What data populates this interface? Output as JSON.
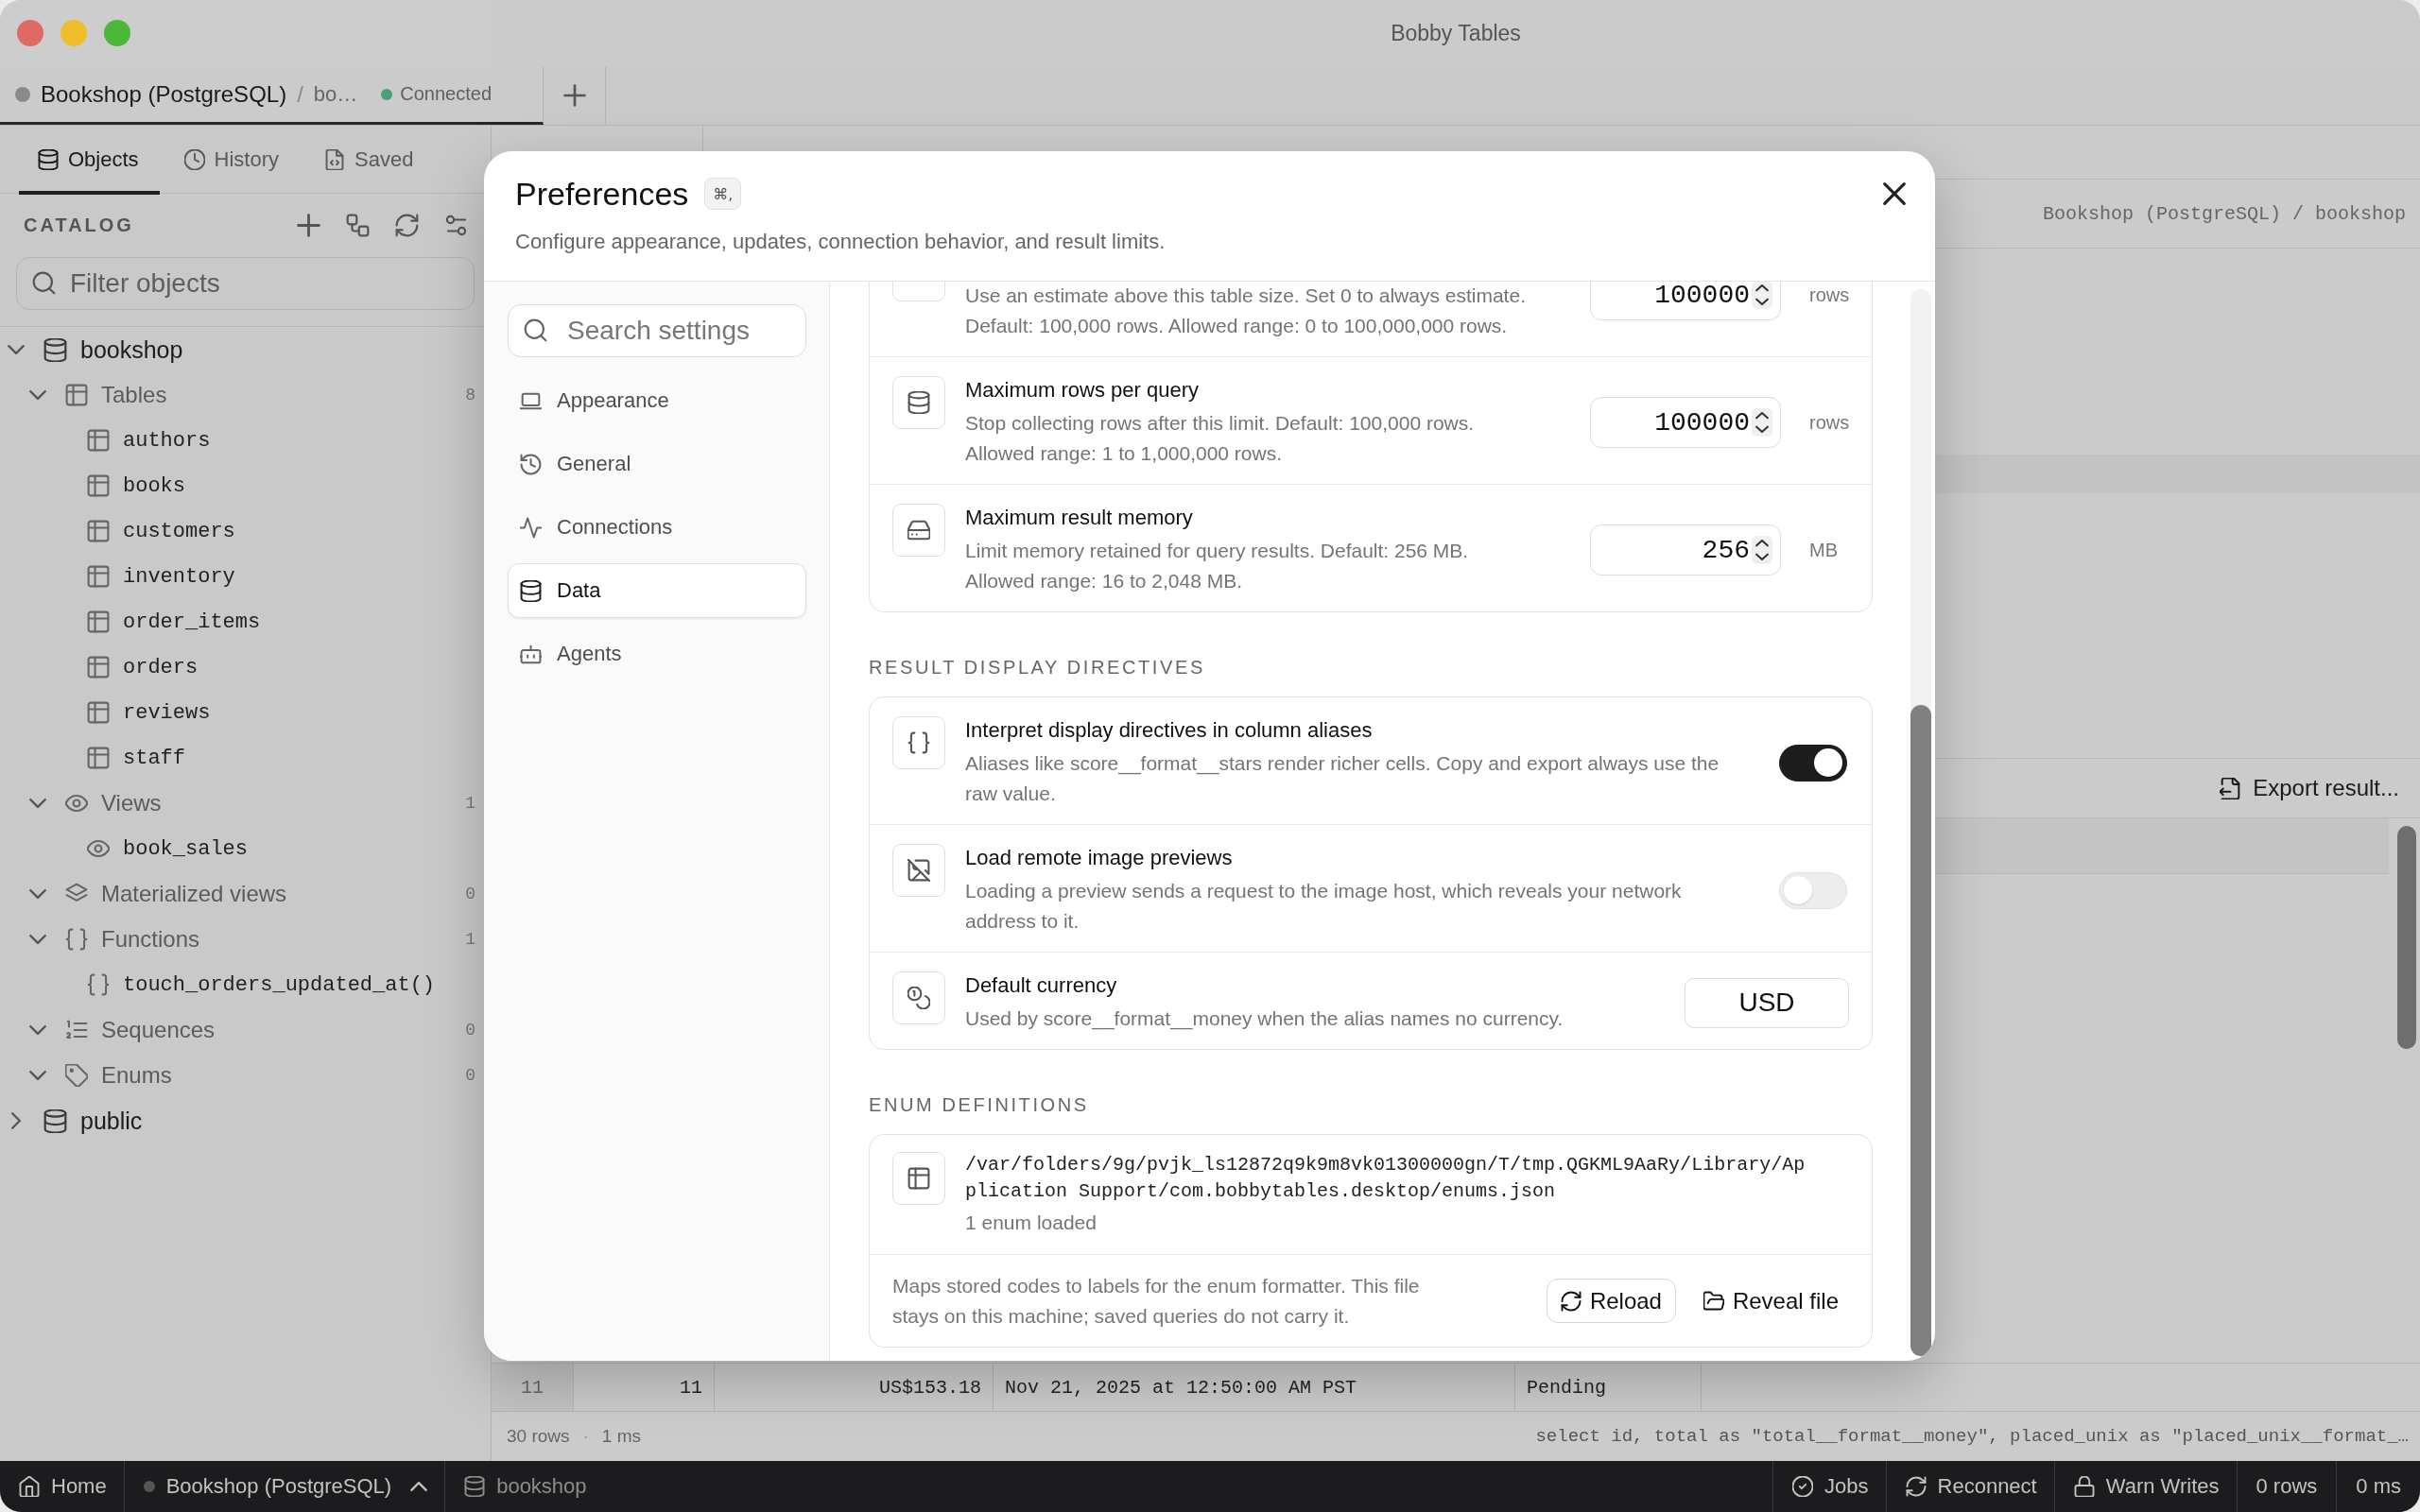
{
  "window": {
    "title": "Bobby Tables"
  },
  "connection_tabs": [
    {
      "connection": "Bookshop (PostgreSQL)",
      "separator": "/",
      "database": "bo…",
      "status": "Connected",
      "connected": true,
      "selected": true
    }
  ],
  "sidebar_tabs": [
    {
      "label": "Objects",
      "selected": true
    },
    {
      "label": "History",
      "selected": false
    },
    {
      "label": "Saved",
      "selected": false
    }
  ],
  "catalog": {
    "title": "CATALOG",
    "filter": {
      "placeholder": "Filter objects"
    },
    "tree": [
      {
        "kind": "database",
        "label": "bookshop",
        "expanded": true,
        "children": [
          {
            "kind": "tables",
            "label": "Tables",
            "count": "8",
            "expanded": true,
            "children": [
              {
                "kind": "table",
                "label": "authors"
              },
              {
                "kind": "table",
                "label": "books"
              },
              {
                "kind": "table",
                "label": "customers"
              },
              {
                "kind": "table",
                "label": "inventory"
              },
              {
                "kind": "table",
                "label": "order_items"
              },
              {
                "kind": "table",
                "label": "orders"
              },
              {
                "kind": "table",
                "label": "reviews"
              },
              {
                "kind": "table",
                "label": "staff"
              }
            ]
          },
          {
            "kind": "views",
            "label": "Views",
            "count": "1",
            "expanded": true,
            "children": [
              {
                "kind": "view",
                "label": "book_sales"
              }
            ]
          },
          {
            "kind": "materialized_views",
            "label": "Materialized views",
            "count": "0",
            "expanded": true
          },
          {
            "kind": "functions",
            "label": "Functions",
            "count": "1",
            "expanded": true,
            "children": [
              {
                "kind": "function",
                "label": "touch_orders_updated_at()"
              }
            ]
          },
          {
            "kind": "sequences",
            "label": "Sequences",
            "count": "0",
            "expanded": true
          },
          {
            "kind": "enums",
            "label": "Enums",
            "count": "0",
            "expanded": true
          }
        ]
      },
      {
        "kind": "database",
        "label": "public",
        "expanded": false
      }
    ]
  },
  "workspace": {
    "breadcrumb": "Bookshop (PostgreSQL) / bookshop",
    "export_button": "Export result...",
    "result_rows": [
      {
        "row_number": "11",
        "cells": [
          "11",
          "US$153.18",
          "Nov 21, 2025 at 12:50:00 AM PST",
          "Pending"
        ]
      }
    ],
    "result_status": {
      "rows": "30 rows",
      "separator": "·",
      "duration": "1 ms",
      "query": "select id, total as \"total__format__money\", placed_unix as \"placed_unix__format_…"
    }
  },
  "preferences": {
    "title": "Preferences",
    "shortcut": "⌘,",
    "subtitle": "Configure appearance, updates, connection behavior, and result limits.",
    "search": {
      "placeholder": "Search settings"
    },
    "nav": [
      {
        "label": "Appearance",
        "selected": false
      },
      {
        "label": "General",
        "selected": false
      },
      {
        "label": "Connections",
        "selected": false
      },
      {
        "label": "Data",
        "selected": true
      },
      {
        "label": "Agents",
        "selected": false
      }
    ],
    "sections": [
      {
        "rows": [
          {
            "kind": "number",
            "description": "Use an estimate above this table size. Set 0 to always estimate. Default: 100,000 rows. Allowed range: 0 to 100,000,000 rows.",
            "value": "100000",
            "unit": "rows"
          },
          {
            "kind": "number",
            "title": "Maximum rows per query",
            "description": "Stop collecting rows after this limit. Default: 100,000 rows. Allowed range: 1 to 1,000,000 rows.",
            "value": "100000",
            "unit": "rows"
          },
          {
            "kind": "number",
            "title": "Maximum result memory",
            "description": "Limit memory retained for query results. Default: 256 MB. Allowed range: 16 to 2,048 MB.",
            "value": "256",
            "unit": "MB"
          }
        ]
      },
      {
        "heading": "RESULT DISPLAY DIRECTIVES",
        "rows": [
          {
            "kind": "toggle",
            "title": "Interpret display directives in column aliases",
            "description": "Aliases like score__format__stars render richer cells. Copy and export always use the raw value.",
            "on": true
          },
          {
            "kind": "toggle",
            "title": "Load remote image previews",
            "description": "Loading a preview sends a request to the image host, which reveals your network address to it.",
            "on": false
          },
          {
            "kind": "text",
            "title": "Default currency",
            "description": "Used by score__format__money when the alias names no currency.",
            "value": "USD"
          }
        ]
      }
    ],
    "enum_definitions": {
      "heading": "ENUM DEFINITIONS",
      "path": "/var/folders/9g/pvjk_ls12872q9k9m8vk01300000gn/T/tmp.QGKML9AaRy/Library/Application Support/com.bobbytables.desktop/enums.json",
      "status": "1 enum loaded",
      "note": "Maps stored codes to labels for the enum formatter. This file stays on this machine; saved queries do not carry it.",
      "buttons": [
        {
          "kind": "outlined",
          "label": "Reload"
        },
        {
          "kind": "plain",
          "label": "Reveal file"
        }
      ]
    }
  },
  "status_bar": {
    "left": [
      {
        "kind": "home",
        "label": "Home"
      },
      {
        "kind": "connection",
        "label": "Bookshop (PostgreSQL)"
      },
      {
        "kind": "database",
        "label": "bookshop"
      }
    ],
    "right": [
      {
        "kind": "jobs",
        "label": "Jobs"
      },
      {
        "kind": "reconnect",
        "label": "Reconnect"
      },
      {
        "kind": "warn_writes",
        "label": "Warn Writes"
      },
      {
        "kind": "metric",
        "label": "0 rows"
      },
      {
        "kind": "metric",
        "label": "0 ms"
      }
    ]
  }
}
